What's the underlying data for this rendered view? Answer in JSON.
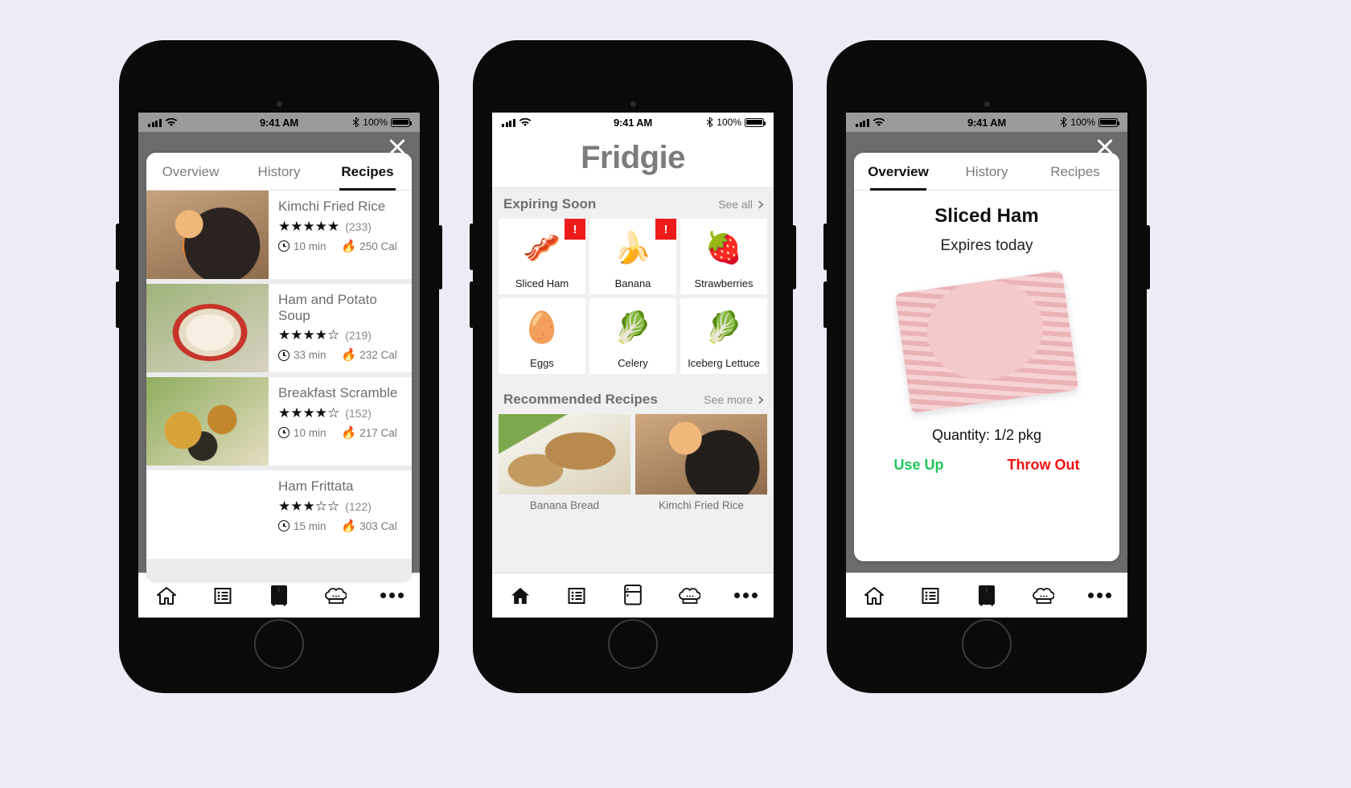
{
  "status_bar": {
    "time": "9:41 AM",
    "battery": "100%"
  },
  "app": {
    "name": "Fridgie"
  },
  "tabs": [
    {
      "label": "Overview"
    },
    {
      "label": "History"
    },
    {
      "label": "Recipes"
    }
  ],
  "nav": [
    {
      "name": "home",
      "icon": "home-icon"
    },
    {
      "name": "list",
      "icon": "list-icon"
    },
    {
      "name": "fridge",
      "icon": "fridge-icon"
    },
    {
      "name": "recipes",
      "icon": "chef-hat-icon"
    },
    {
      "name": "more",
      "icon": "ellipsis-icon"
    }
  ],
  "phone1": {
    "active_tab": "Recipes",
    "close_label": "close-icon",
    "recipes": [
      {
        "title": "Kimchi Fried Rice",
        "stars": 5,
        "reviews": "(233)",
        "time": "10 min",
        "calories": "250 Cal"
      },
      {
        "title": "Ham and Potato Soup",
        "stars": 4,
        "reviews": "(219)",
        "time": "33 min",
        "calories": "232 Cal"
      },
      {
        "title": "Breakfast Scramble",
        "stars": 4,
        "reviews": "(152)",
        "time": "10 min",
        "calories": "217 Cal"
      },
      {
        "title": "Ham Frittata",
        "stars": 3,
        "reviews": "(122)",
        "time": "15 min",
        "calories": "303 Cal"
      }
    ]
  },
  "phone2": {
    "title": "Fridgie",
    "expiring": {
      "heading": "Expiring Soon",
      "see_all": "See all",
      "items": [
        {
          "label": "Sliced Ham",
          "emoji": "🍖",
          "alert": "!"
        },
        {
          "label": "Banana",
          "emoji": "🍌",
          "alert": "!"
        },
        {
          "label": "Strawberries",
          "emoji": "🍓",
          "alert": ""
        },
        {
          "label": "Eggs",
          "emoji": "🥚",
          "alert": ""
        },
        {
          "label": "Celery",
          "emoji": "🥬",
          "alert": ""
        },
        {
          "label": "Iceberg Lettuce",
          "emoji": "🥬",
          "alert": ""
        }
      ]
    },
    "recommended": {
      "heading": "Recommended Recipes",
      "see_more": "See more",
      "items": [
        {
          "name": "Banana Bread"
        },
        {
          "name": "Kimchi Fried Rice"
        }
      ]
    }
  },
  "phone3": {
    "active_tab": "Overview",
    "item_name": "Sliced Ham",
    "expiry": "Expires today",
    "quantity": "Quantity: 1/2 pkg",
    "use_up": "Use Up",
    "throw_out": "Throw Out",
    "colors": {
      "use_up": "#22c55e",
      "throw_out": "#ee1111",
      "alert": "#ee1b1b"
    }
  }
}
